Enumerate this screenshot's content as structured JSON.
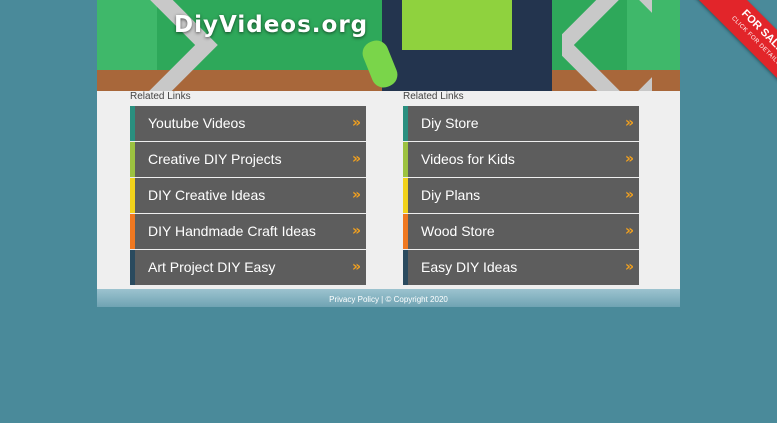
{
  "header": {
    "site_title": "DiyVideos.org"
  },
  "ribbon": {
    "line1": "FOR SALE!",
    "line2": "CLICK FOR DETAILS"
  },
  "left_column": {
    "title": "Related Links",
    "items": [
      {
        "label": "Youtube Videos",
        "accent": "#2a8f7f"
      },
      {
        "label": "Creative DIY Projects",
        "accent": "#9cc240"
      },
      {
        "label": "DIY Creative Ideas",
        "accent": "#f2d21b"
      },
      {
        "label": "DIY Handmade Craft Ideas",
        "accent": "#f07820"
      },
      {
        "label": "Art Project DIY Easy",
        "accent": "#2a4a5e"
      }
    ]
  },
  "right_column": {
    "title": "Related Links",
    "items": [
      {
        "label": "Diy Store",
        "accent": "#2a8f7f"
      },
      {
        "label": "Videos for Kids",
        "accent": "#9cc240"
      },
      {
        "label": "Diy Plans",
        "accent": "#f2d21b"
      },
      {
        "label": "Wood Store",
        "accent": "#f07820"
      },
      {
        "label": "Easy DIY Ideas",
        "accent": "#2a4a5e"
      }
    ]
  },
  "arrow_icon": "»",
  "footer": {
    "text": "Privacy Policy | © Copyright 2020"
  }
}
